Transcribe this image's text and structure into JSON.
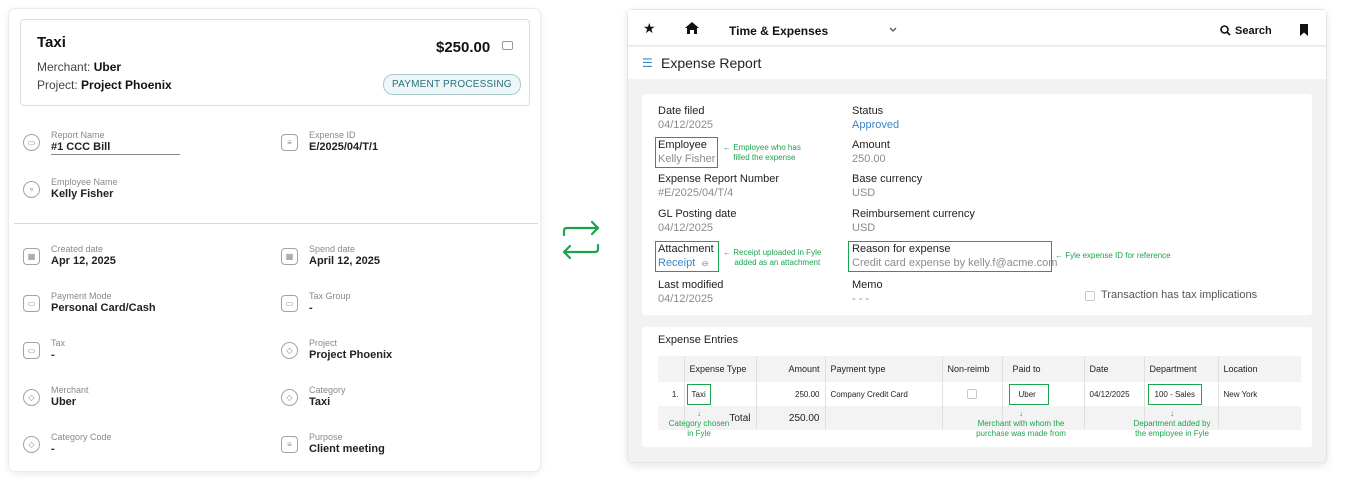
{
  "left_card": {
    "title": "Taxi",
    "merchant_label": "Merchant:",
    "merchant": "Uber",
    "project_label": "Project:",
    "project": "Project Phoenix",
    "amount": "$250.00",
    "status_badge": "PAYMENT PROCESSING",
    "fields": {
      "report_name": {
        "label": "Report Name",
        "value": "#1 CCC Bill"
      },
      "expense_id": {
        "label": "Expense ID",
        "value": "E/2025/04/T/1"
      },
      "employee_name": {
        "label": "Employee Name",
        "value": "Kelly Fisher"
      },
      "created_date": {
        "label": "Created date",
        "value": "Apr 12, 2025"
      },
      "spend_date": {
        "label": "Spend date",
        "value": "April 12, 2025"
      },
      "payment_mode": {
        "label": "Payment Mode",
        "value": "Personal Card/Cash"
      },
      "tax_group": {
        "label": "Tax Group",
        "value": "-"
      },
      "tax": {
        "label": "Tax",
        "value": "-"
      },
      "project": {
        "label": "Project",
        "value": "Project Phoenix"
      },
      "merchant": {
        "label": "Merchant",
        "value": "Uber"
      },
      "category": {
        "label": "Category",
        "value": "Taxi"
      },
      "category_code": {
        "label": "Category Code",
        "value": "-"
      },
      "purpose": {
        "label": "Purpose",
        "value": "Client meeting"
      }
    }
  },
  "right_window": {
    "topbar": {
      "module": "Time & Expenses",
      "search": "Search"
    },
    "page_title": "Expense Report",
    "details": {
      "date_filed": {
        "label": "Date filed",
        "value": "04/12/2025"
      },
      "status": {
        "label": "Status",
        "value": "Approved"
      },
      "employee": {
        "label": "Employee",
        "value": "Kelly Fisher"
      },
      "amount": {
        "label": "Amount",
        "value": "250.00"
      },
      "report_number": {
        "label": "Expense Report Number",
        "value": "#E/2025/04/T/4"
      },
      "base_currency": {
        "label": "Base currency",
        "value": "USD"
      },
      "gl_posting": {
        "label": "GL Posting date",
        "value": "04/12/2025"
      },
      "reimb_currency": {
        "label": "Reimbursement currency",
        "value": "USD"
      },
      "attachment": {
        "label": "Attachment",
        "value": "Receipt"
      },
      "reason": {
        "label": "Reason for expense",
        "value": "Credit card expense by kelly.f@acme.com"
      },
      "last_modified": {
        "label": "Last modified",
        "value": "04/12/2025"
      },
      "memo": {
        "label": "Memo",
        "value": "- - -"
      },
      "tax_checkbox": "Transaction has tax implications"
    },
    "entries": {
      "title": "Expense Entries",
      "headers": [
        "Expense Type",
        "Amount",
        "Payment type",
        "Non-reimb",
        "Paid to",
        "Date",
        "Department",
        "Location"
      ],
      "row": {
        "num": "1.",
        "expense_type": "Taxi",
        "amount": "250.00",
        "payment_type": "Company Credit Card",
        "paid_to": "Uber",
        "date": "04/12/2025",
        "department": "100 - Sales",
        "location": "New York"
      },
      "total_label": "Total",
      "total_value": "250.00"
    },
    "annotations": {
      "employee": "Employee who has\nfilled the expense",
      "receipt": "Receipt uploaded in Fyle\nadded as an attachment",
      "reason": "Fyle expense ID for reference",
      "category": "Category chosen\nin Fyle",
      "merchant": "Merchant with whom the\npurchase was made from",
      "department": "Department added by\nthe employee in Fyle"
    }
  },
  "colors": {
    "green": "#1da34e",
    "link": "#3b86c4",
    "badge": "#2b6f7a"
  }
}
